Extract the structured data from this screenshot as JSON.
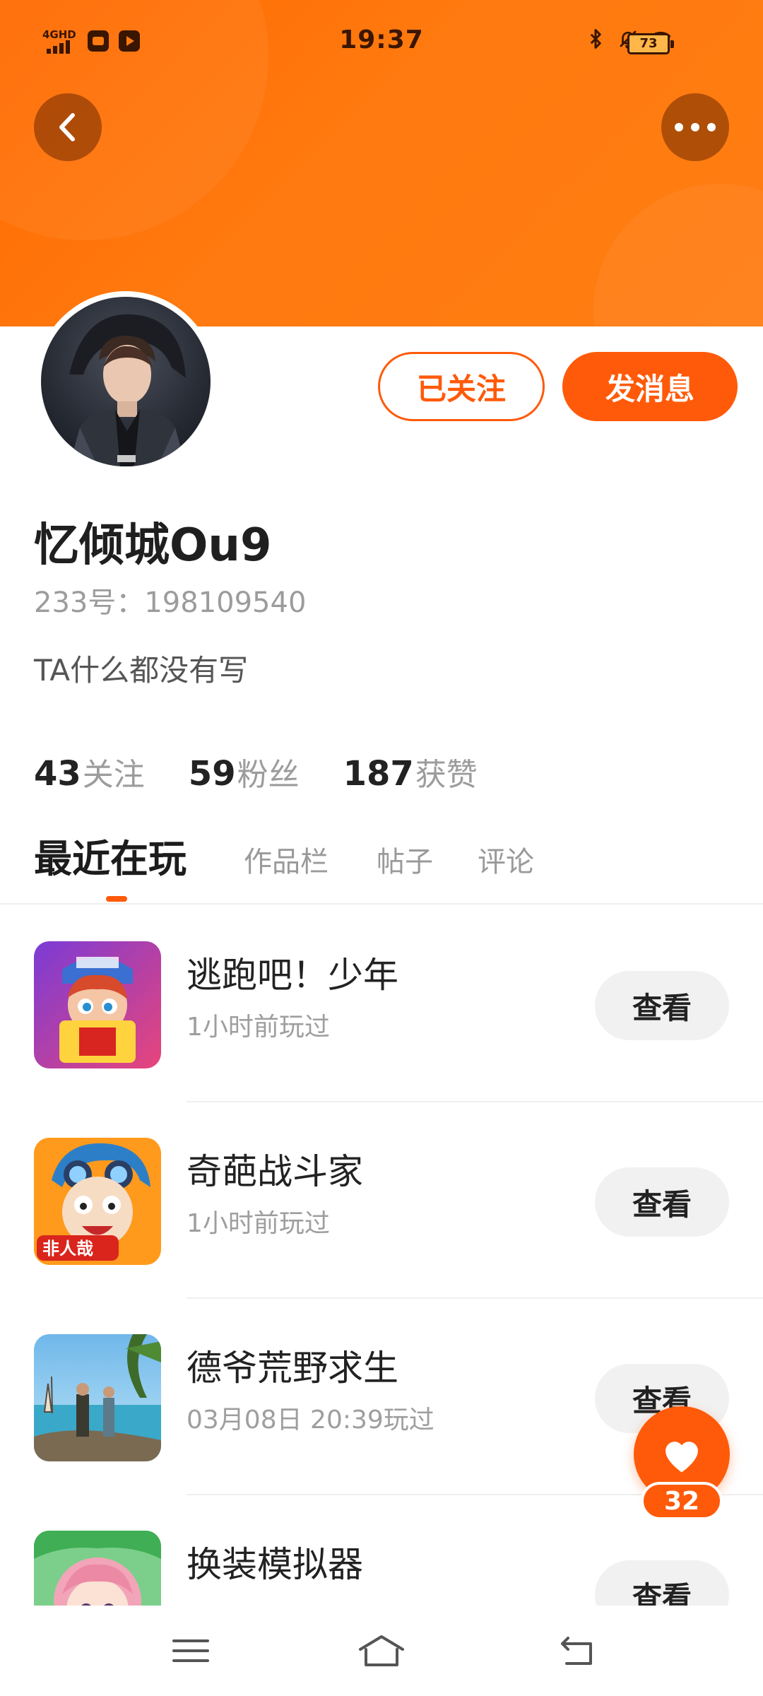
{
  "status_bar": {
    "network": "4GHD",
    "time": "19:37",
    "battery": "73"
  },
  "header": {
    "back_icon": "chevron-left-icon",
    "more_icon": "more-dots-icon",
    "accent_color": "#ff5a0a"
  },
  "profile": {
    "follow_label": "已关注",
    "message_label": "发消息",
    "username": "忆倾城Ou9",
    "uid": "233号：198109540",
    "bio": "TA什么都没有写"
  },
  "stats": [
    {
      "num": "43",
      "label": "关注"
    },
    {
      "num": "59",
      "label": "粉丝"
    },
    {
      "num": "187",
      "label": "获赞"
    }
  ],
  "tabs": [
    {
      "label": "最近在玩",
      "active": true
    },
    {
      "label": "作品栏",
      "active": false
    },
    {
      "label": "帖子",
      "active": false
    },
    {
      "label": "评论",
      "active": false
    }
  ],
  "games": [
    {
      "name": "逃跑吧！少年",
      "time": "1小时前玩过",
      "button": "查看"
    },
    {
      "name": "奇葩战斗家",
      "time": "1小时前玩过",
      "button": "查看"
    },
    {
      "name": "德爷荒野求生",
      "time": "03月08日 20:39玩过",
      "button": "查看"
    },
    {
      "name": "换装模拟器",
      "time": "",
      "button": "查看"
    }
  ],
  "fab": {
    "icon": "heart-icon",
    "count": "32"
  },
  "nav": {
    "menu_icon": "menu-icon",
    "home_icon": "home-icon",
    "back_icon": "return-icon"
  }
}
